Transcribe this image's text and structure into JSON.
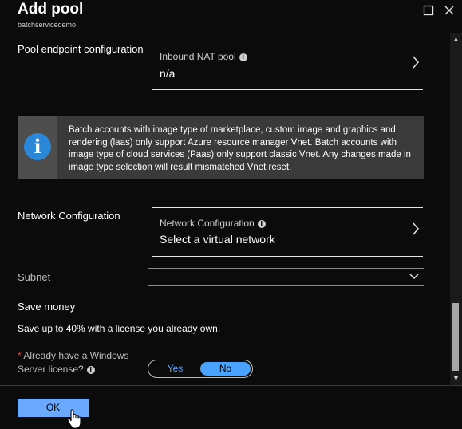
{
  "header": {
    "title": "Add pool",
    "subtitle": "batchservicedemo"
  },
  "pool_endpoint": {
    "label": "Pool endpoint configuration",
    "selector": {
      "caption": "Inbound NAT pool",
      "value": "n/a"
    }
  },
  "info": {
    "text": "Batch accounts with image type of marketplace, custom image and graphics and rendering (laas) only support Azure resource manager Vnet. Batch accounts with image type of cloud services (Paas) only support classic Vnet. Any changes made in image type selection will result mismatched Vnet reset."
  },
  "network": {
    "label": "Network Configuration",
    "selector": {
      "caption": "Network Configuration",
      "value": "Select a virtual network"
    }
  },
  "subnet": {
    "label": "Subnet",
    "value": ""
  },
  "save_money": {
    "heading": "Save money",
    "text": "Save up to 40% with a license you already own.",
    "required_mark": "*",
    "question_line1": "Already have a Windows",
    "question_line2": "Server license?",
    "options": [
      "Yes",
      "No"
    ],
    "selected": "No"
  },
  "footer": {
    "ok_label": "OK"
  },
  "icons": {
    "info": "info-icon",
    "chevron_right": "chevron-right-icon",
    "chevron_down": "chevron-down-icon",
    "maximize": "maximize-icon",
    "close": "close-icon",
    "cursor": "hand-cursor-icon"
  },
  "colors": {
    "accent": "#2b88d8",
    "toggle_selected": "#4aa3ff",
    "ok_button": "#6aa9ff",
    "required": "#e04040"
  }
}
